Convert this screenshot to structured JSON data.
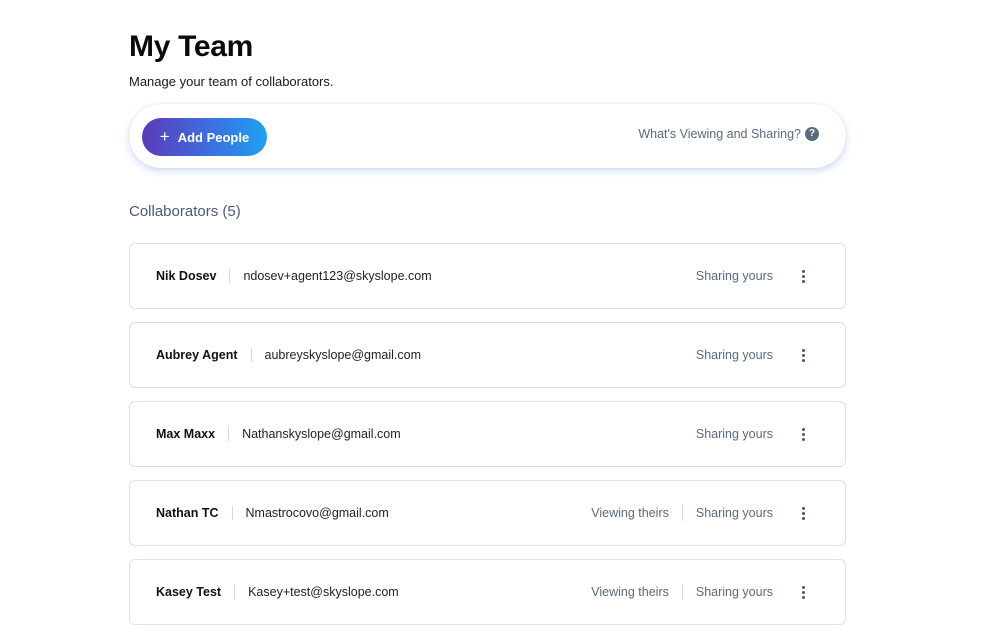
{
  "header": {
    "title": "My Team",
    "subtitle": "Manage your team of collaborators."
  },
  "action_bar": {
    "add_label": "Add People",
    "help_label": "What's Viewing and Sharing?",
    "help_icon": "question-icon"
  },
  "collaborators": {
    "heading": "Collaborators (5)",
    "items": [
      {
        "name": "Nik Dosev",
        "email": "ndosev+agent123@skyslope.com",
        "viewing": "",
        "sharing": "Sharing yours"
      },
      {
        "name": "Aubrey Agent",
        "email": "aubreyskyslope@gmail.com",
        "viewing": "",
        "sharing": "Sharing yours"
      },
      {
        "name": "Max Maxx",
        "email": "Nathanskyslope@gmail.com",
        "viewing": "",
        "sharing": "Sharing yours"
      },
      {
        "name": "Nathan TC",
        "email": "Nmastrocovo@gmail.com",
        "viewing": "Viewing theirs",
        "sharing": "Sharing yours"
      },
      {
        "name": "Kasey Test",
        "email": "Kasey+test@skyslope.com",
        "viewing": "Viewing theirs",
        "sharing": "Sharing yours"
      }
    ]
  },
  "colors": {
    "gradient_start": "#5a3cb8",
    "gradient_end": "#1fa0f2",
    "muted_text": "#5a6a80",
    "border": "#dde1e6"
  }
}
